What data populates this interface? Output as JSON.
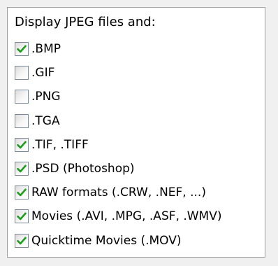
{
  "panel": {
    "heading": "Display JPEG files and:",
    "options": [
      {
        "label": ".BMP",
        "checked": true
      },
      {
        "label": ".GIF",
        "checked": false
      },
      {
        "label": ".PNG",
        "checked": false
      },
      {
        "label": ".TGA",
        "checked": false
      },
      {
        "label": ".TIF, .TIFF",
        "checked": true
      },
      {
        "label": ".PSD (Photoshop)",
        "checked": true
      },
      {
        "label": "RAW formats (.CRW, .NEF, ...)",
        "checked": true
      },
      {
        "label": "Movies (.AVI, .MPG, .ASF, .WMV)",
        "checked": true
      },
      {
        "label": "Quicktime Movies (.MOV)",
        "checked": true
      }
    ]
  },
  "colors": {
    "checkmark": "#1e9c1e",
    "border": "#7a8a99"
  }
}
